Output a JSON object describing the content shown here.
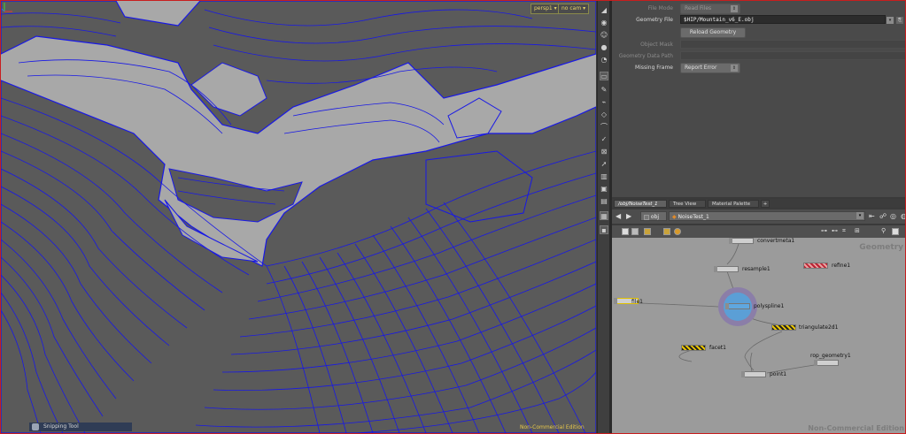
{
  "viewport": {
    "camera_menu": "persp1 ▾",
    "cam_menu": "no cam ▾",
    "status_text": "Snipping Tool",
    "nc_label": "Non-Commercial Edition",
    "colors": {
      "terrain": "#5a5a5a",
      "contour": "#1818e6",
      "background": "#a8a8a8"
    }
  },
  "params": {
    "file_mode": {
      "label": "File Mode",
      "value": "Read Files"
    },
    "geometry_file": {
      "label": "Geometry File",
      "value": "$HIP/Mountain_v6_E.obj"
    },
    "reload_button": "Reload Geometry",
    "object_mask": {
      "label": "Object Mask"
    },
    "geometry_data_path": {
      "label": "Geometry Data Path"
    },
    "missing_frame": {
      "label": "Missing Frame",
      "value": "Report Error"
    }
  },
  "network": {
    "tabs": [
      "/obj/NoiseTest_1",
      "Tree View",
      "Material Palette"
    ],
    "path": {
      "root": "obj",
      "node": "NoiseTest_1"
    },
    "context_label": "Geometry",
    "nc_label": "Non-Commercial Edition",
    "nodes": {
      "convertmeta": "convertmeta1",
      "resample": "resample1",
      "refine": "refine1",
      "file": "file1",
      "polyspline": "polyspline1",
      "triangulate": "triangulate2d1",
      "facet": "facet1",
      "rop_geometry": "rop_geometry1",
      "point": "point1"
    }
  }
}
